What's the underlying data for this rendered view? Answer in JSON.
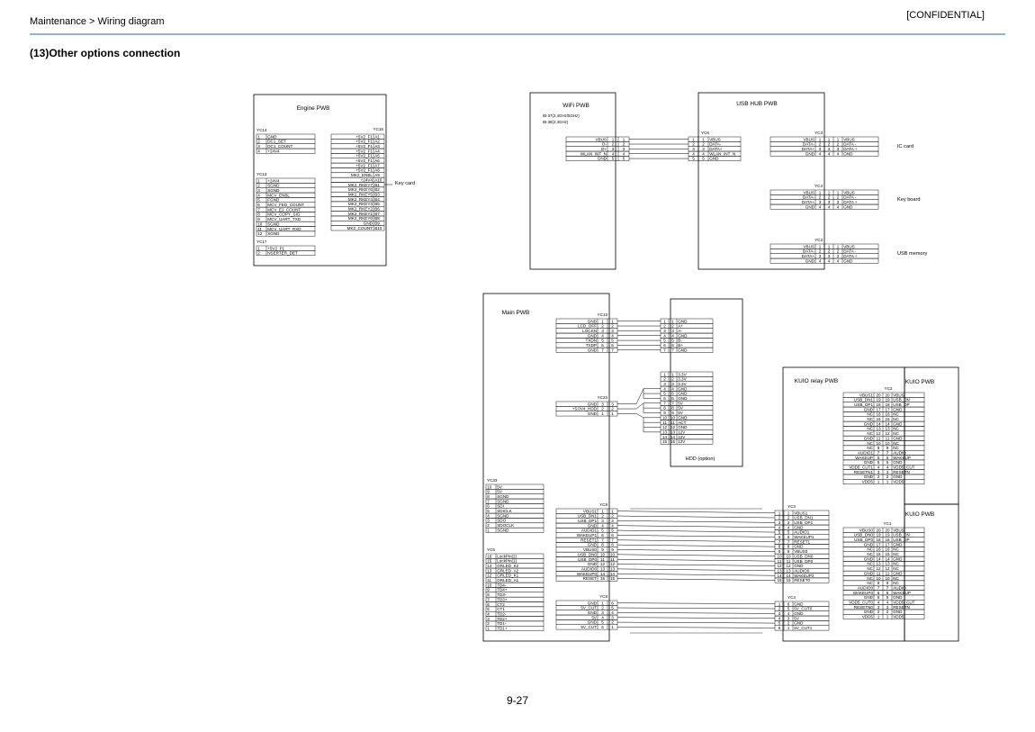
{
  "header": {
    "breadcrumb": "Maintenance > Wiring diagram",
    "classification": "[CONFIDENTIAL]"
  },
  "section_title": "(13)Other options connection",
  "page_number": "9-27",
  "engine_pwb": {
    "title": "Engine PWB",
    "yc14": {
      "label": "YC14",
      "rows": [
        [
          "1",
          "GND"
        ],
        [
          "2",
          "DC1_SET"
        ],
        [
          "3",
          "DC1_COUNT"
        ],
        [
          "4",
          "+24V4"
        ]
      ]
    },
    "yc13": {
      "label": "YC13",
      "rows": [
        [
          "1",
          "+24V4"
        ],
        [
          "2",
          "SGND"
        ],
        [
          "3",
          "SGND"
        ],
        [
          "4",
          "MCV_ENBL"
        ],
        [
          "5",
          "FGND"
        ],
        [
          "6",
          "MCV_FED_COUNT"
        ],
        [
          "7",
          "MCV_EJ_COUNT"
        ],
        [
          "8",
          "MCV_COPY_SIG"
        ],
        [
          "9",
          "MCV_UART_TXD"
        ],
        [
          "10",
          "SGND"
        ],
        [
          "11",
          "MCV_UART_RXD"
        ],
        [
          "12",
          "SGND"
        ]
      ]
    },
    "yc17": {
      "label": "YC17",
      "rows": [
        [
          "1",
          "+5V2_F1"
        ],
        [
          "2",
          "NSERTER_DET"
        ]
      ]
    },
    "yc15": {
      "label": "YC15",
      "rows": [
        [
          "+5V2_F1",
          "A1"
        ],
        [
          "+5V2_F1",
          "A2"
        ],
        [
          "+5V2_F1",
          "A3"
        ],
        [
          "+5V2_F1",
          "A4"
        ],
        [
          "+5V2_F1",
          "A5"
        ],
        [
          "+5V2_F1",
          "A6"
        ],
        [
          "+5V2_F1",
          "A7"
        ],
        [
          "+5V2_F1",
          "A8"
        ],
        [
          "MK2_ENBL",
          "A9"
        ],
        [
          "+24V4",
          "A10"
        ],
        [
          "MK2_RKEY7",
          "B1"
        ],
        [
          "MK2_RKEY6",
          "B2"
        ],
        [
          "MK2_RKEY5",
          "B3"
        ],
        [
          "MK2_RKEY4",
          "B4"
        ],
        [
          "MK2_RKEY3",
          "B5"
        ],
        [
          "MK2_RKEY2",
          "B6"
        ],
        [
          "MK2_RKEY1",
          "B7"
        ],
        [
          "MK2_RKEY0",
          "B8"
        ],
        [
          "GND",
          "B9"
        ],
        [
          "MK2_COUNT",
          "B10"
        ]
      ]
    },
    "key_card_label": "Key card"
  },
  "wifi_pwb": {
    "title": "WiFi PWB",
    "note1": "IB-37(2.4GHz/5GHz)",
    "note2": "IB-38(2.4GHz)",
    "rows": [
      [
        "VBUS",
        "1",
        "1"
      ],
      [
        "D-",
        "2",
        "2"
      ],
      [
        "D+",
        "3",
        "3"
      ],
      [
        "WLAN_INT_N",
        "4",
        "4"
      ],
      [
        "GND",
        "5",
        "5"
      ]
    ]
  },
  "usb_hub_pwb": {
    "title": "USB HUB PWB",
    "yc6": {
      "label": "YC6",
      "rows": [
        [
          "1",
          "1",
          "VBUS"
        ],
        [
          "2",
          "2",
          "DATA-"
        ],
        [
          "3",
          "3",
          "DATA+"
        ],
        [
          "4",
          "4",
          "WLAN_INT_N"
        ],
        [
          "5",
          "5",
          "GND"
        ]
      ]
    },
    "yc3": {
      "label": "YC3",
      "dest": "IC card",
      "rows": [
        [
          "VBUS",
          "1",
          "1",
          "1",
          "VBUS"
        ],
        [
          "DATA-",
          "2",
          "2",
          "2",
          "DATA -"
        ],
        [
          "DATA+",
          "3",
          "3",
          "3",
          "DATA +"
        ],
        [
          "GND",
          "4",
          "4",
          "4",
          "GND"
        ]
      ]
    },
    "yc4": {
      "label": "YC4",
      "dest": "Key board",
      "rows": [
        [
          "VBUS",
          "1",
          "1",
          "1",
          "VBUS"
        ],
        [
          "DATA-",
          "2",
          "2",
          "2",
          "DATA -"
        ],
        [
          "DATA+",
          "3",
          "3",
          "3",
          "DATA +"
        ],
        [
          "GND",
          "4",
          "4",
          "4",
          "GND"
        ]
      ]
    },
    "yc2": {
      "label": "YC2",
      "dest": "USB memory",
      "rows": [
        [
          "VBUS",
          "1",
          "1",
          "1",
          "VBUS"
        ],
        [
          "DATA-",
          "2",
          "2",
          "2",
          "DATA -"
        ],
        [
          "DATA+",
          "3",
          "3",
          "3",
          "DATA +"
        ],
        [
          "GND",
          "4",
          "4",
          "4",
          "GND"
        ]
      ]
    }
  },
  "main_pwb": {
    "title": "Main PWB",
    "yc13": {
      "label": "YC13",
      "rows": [
        [
          "GND",
          "1",
          "1"
        ],
        [
          "LCD_OFF",
          "2",
          "2"
        ],
        [
          "LOCKN",
          "3",
          "3"
        ],
        [
          "GND",
          "4",
          "4"
        ],
        [
          "TXDN",
          "5",
          "5"
        ],
        [
          "TXDP",
          "6",
          "6"
        ],
        [
          "GND",
          "7",
          "7"
        ]
      ]
    },
    "yc23": {
      "label": "YC23",
      "rows": [
        [
          "GND",
          "3",
          "3"
        ],
        [
          "+5.0V4_HDD",
          "2",
          "2"
        ],
        [
          "GND",
          "1",
          "1"
        ]
      ]
    },
    "yc33": {
      "label": "YC33",
      "rows": [
        [
          "10",
          "5V"
        ],
        [
          "9",
          "5V"
        ],
        [
          "8",
          "SGND"
        ],
        [
          "7",
          "SGND"
        ],
        [
          "6",
          "SDI"
        ],
        [
          "5",
          "SDICLK"
        ],
        [
          "4",
          "SGND"
        ],
        [
          "3",
          "SDO"
        ],
        [
          "2",
          "SDOCLK"
        ],
        [
          "1",
          "SGND"
        ]
      ]
    },
    "yc5": {
      "label": "YC5",
      "rows": [
        [
          "16",
          "LockPin(2)"
        ],
        [
          "15",
          "LockPin(1)"
        ],
        [
          "14",
          "GRLED_K2"
        ],
        [
          "13",
          "GRLED_A2"
        ],
        [
          "12",
          "GRLED_K1"
        ],
        [
          "11",
          "GRLED_A1"
        ],
        [
          "10",
          "TD4-"
        ],
        [
          "9",
          "TD4+"
        ],
        [
          "8",
          "TD3-"
        ],
        [
          "7",
          "TD3+"
        ],
        [
          "6",
          "CT2"
        ],
        [
          "5",
          "CT1"
        ],
        [
          "4",
          "TD2-"
        ],
        [
          "3",
          "TD2+"
        ],
        [
          "2",
          "TD1-"
        ],
        [
          "1",
          "TD1+"
        ]
      ]
    },
    "yc9": {
      "label": "YC9",
      "rows": [
        [
          "VBUS1",
          "1",
          "1"
        ],
        [
          "USB_DN1",
          "2",
          "2"
        ],
        [
          "USB_DP1",
          "3",
          "3"
        ],
        [
          "GND",
          "4",
          "4"
        ],
        [
          "AUDIO1",
          "5",
          "5"
        ],
        [
          "WAKEUP1",
          "6",
          "6"
        ],
        [
          "RESET1",
          "7",
          "7"
        ],
        [
          "GND",
          "8",
          "8"
        ],
        [
          "VBUS0",
          "9",
          "9"
        ],
        [
          "USB_DN0",
          "10",
          "10"
        ],
        [
          "USB_DP0",
          "11",
          "11"
        ],
        [
          "GND",
          "12",
          "12"
        ],
        [
          "AUDIO0",
          "13",
          "13"
        ],
        [
          "WAKEUP0",
          "14",
          "14"
        ],
        [
          "RESET",
          "15",
          "15"
        ]
      ]
    },
    "yc8": {
      "label": "YC8",
      "rows": [
        [
          "GND",
          "1",
          "6"
        ],
        [
          "5V_CUT",
          "2",
          "5"
        ],
        [
          "GND",
          "3",
          "4"
        ],
        [
          "5V",
          "4",
          "3"
        ],
        [
          "GND",
          "5",
          "2"
        ],
        [
          "5V_CUT",
          "6",
          "1"
        ]
      ]
    }
  },
  "hdd": {
    "label": "HDD (option)",
    "top_rows": [
      [
        "1",
        "1",
        "GND"
      ],
      [
        "2",
        "2",
        "A+"
      ],
      [
        "3",
        "3",
        "A-"
      ],
      [
        "4",
        "4",
        "GND"
      ],
      [
        "5",
        "5",
        "B-"
      ],
      [
        "6",
        "6",
        "B+"
      ],
      [
        "7",
        "7",
        "GND"
      ]
    ],
    "power_rows": [
      [
        "1",
        "1",
        "3.3V"
      ],
      [
        "2",
        "2",
        "3.3V"
      ],
      [
        "3",
        "3",
        "3.3V"
      ],
      [
        "4",
        "4",
        "GND"
      ],
      [
        "5",
        "5",
        "GND"
      ],
      [
        "6",
        "6",
        "GND"
      ],
      [
        "7",
        "7",
        "5V"
      ],
      [
        "8",
        "8",
        "5V"
      ],
      [
        "9",
        "9",
        "5V"
      ],
      [
        "10",
        "10",
        "GND"
      ],
      [
        "11",
        "11",
        "ACT"
      ],
      [
        "12",
        "12",
        "GND"
      ],
      [
        "13",
        "13",
        "12V"
      ],
      [
        "14",
        "14",
        "12V"
      ],
      [
        "15",
        "15",
        "12V"
      ]
    ]
  },
  "kuio_relay": {
    "title": "KUIO relay PWB",
    "yc3": {
      "label": "YC3",
      "rows": [
        [
          "1",
          "1",
          "VBUS1"
        ],
        [
          "2",
          "2",
          "USB_DN1"
        ],
        [
          "3",
          "3",
          "USB_DP1"
        ],
        [
          "4",
          "4",
          "GND"
        ],
        [
          "5",
          "5",
          "AUDIO1"
        ],
        [
          "6",
          "6",
          "WAKEUP1"
        ],
        [
          "7",
          "7",
          "RESET1"
        ],
        [
          "8",
          "8",
          "GND"
        ],
        [
          "9",
          "9",
          "VBUS0"
        ],
        [
          "10",
          "10",
          "USB_DN0"
        ],
        [
          "11",
          "11",
          "USB_DP0"
        ],
        [
          "12",
          "12",
          "GND"
        ],
        [
          "13",
          "13",
          "AUDIO0"
        ],
        [
          "14",
          "14",
          "WAKEUP2"
        ],
        [
          "15",
          "15",
          "RESET0"
        ]
      ]
    },
    "yc4": {
      "label": "YC4",
      "rows": [
        [
          "1",
          "6",
          "GND"
        ],
        [
          "2",
          "5",
          "5V_CUT0"
        ],
        [
          "3",
          "4",
          "GND"
        ],
        [
          "4",
          "3",
          "5V"
        ],
        [
          "5",
          "2",
          "GND"
        ],
        [
          "6",
          "1",
          "5V_CUT1"
        ]
      ]
    },
    "yc2": {
      "label": "YC2",
      "rows": [
        [
          "VBUS1",
          "20",
          "20",
          "VBUS"
        ],
        [
          "USB_DN1",
          "19",
          "19",
          "USB_DN"
        ],
        [
          "USB_DP1",
          "18",
          "18",
          "USB_DP"
        ],
        [
          "GND",
          "17",
          "17",
          "GND"
        ],
        [
          "NC",
          "16",
          "16",
          "NC"
        ],
        [
          "NC",
          "15",
          "15",
          "NC"
        ],
        [
          "GND",
          "14",
          "14",
          "GND"
        ],
        [
          "NC",
          "13",
          "13",
          "NC"
        ],
        [
          "NC",
          "12",
          "12",
          "NC"
        ],
        [
          "GND",
          "11",
          "11",
          "GND"
        ],
        [
          "NC",
          "10",
          "10",
          "NC"
        ],
        [
          "NC",
          "9",
          "9",
          "NC"
        ],
        [
          "AUDIO1",
          "7",
          "7",
          "AUDIO"
        ],
        [
          "WAKEUP",
          "6",
          "6",
          "WAKEUP"
        ],
        [
          "GND",
          "5",
          "5",
          "GND"
        ],
        [
          "VDD5_CUT1",
          "4",
          "4",
          "VDD5_CUT"
        ],
        [
          "RESETN1",
          "3",
          "3",
          "RESETN"
        ],
        [
          "GND",
          "2",
          "2",
          "GND"
        ],
        [
          "VDD5",
          "1",
          "1",
          "VDD5"
        ]
      ]
    },
    "yc1": {
      "label": "YC1",
      "rows": [
        [
          "VBUS0",
          "20",
          "20",
          "VBUS"
        ],
        [
          "USB_DN0",
          "19",
          "19",
          "USB_DN"
        ],
        [
          "USB_DP0",
          "18",
          "18",
          "USB_DP"
        ],
        [
          "GND",
          "17",
          "17",
          "GND"
        ],
        [
          "NC",
          "16",
          "16",
          "NC"
        ],
        [
          "NC",
          "15",
          "15",
          "NC"
        ],
        [
          "GND",
          "14",
          "14",
          "GND"
        ],
        [
          "NC",
          "13",
          "13",
          "NC"
        ],
        [
          "NC",
          "12",
          "12",
          "NC"
        ],
        [
          "GND",
          "11",
          "11",
          "GND"
        ],
        [
          "NC",
          "10",
          "10",
          "NC"
        ],
        [
          "NC",
          "9",
          "9",
          "NC"
        ],
        [
          "AUDIO0",
          "7",
          "7",
          "AUDIO"
        ],
        [
          "WAKEUP0",
          "6",
          "6",
          "WAKEUP"
        ],
        [
          "GND",
          "5",
          "5",
          "GND"
        ],
        [
          "VDD5_CUT0",
          "4",
          "4",
          "VDD5_CUT"
        ],
        [
          "RESETN0",
          "3",
          "3",
          "RESETN"
        ],
        [
          "GND",
          "2",
          "2",
          "GND"
        ],
        [
          "VDD5",
          "1",
          "1",
          "VDD5"
        ]
      ]
    }
  },
  "kuio_pwb_label": "KUIO PWB"
}
